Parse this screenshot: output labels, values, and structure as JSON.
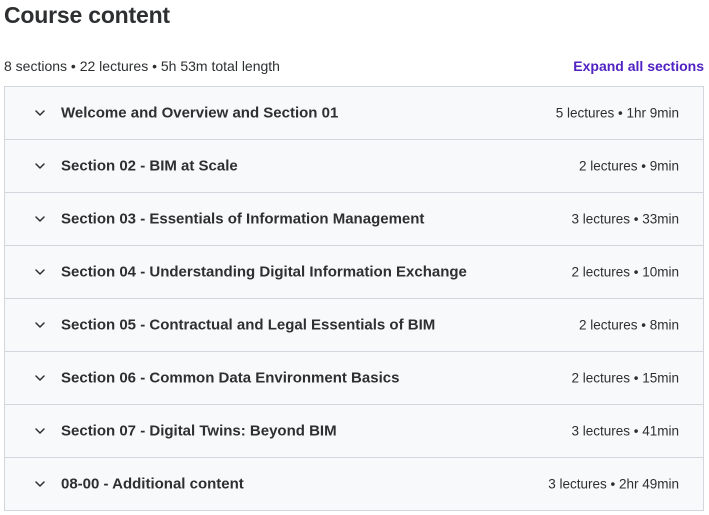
{
  "header": {
    "title": "Course content",
    "summary": "8 sections • 22 lectures • 5h 53m total length",
    "expand_label": "Expand all sections"
  },
  "sections": [
    {
      "title": "Welcome and Overview and Section 01",
      "meta": "5 lectures • 1hr 9min",
      "icon": "chevron-down-icon"
    },
    {
      "title": "Section 02 - BIM at Scale",
      "meta": "2 lectures • 9min",
      "icon": "chevron-down-icon"
    },
    {
      "title": "Section 03 - Essentials of Information Management",
      "meta": "3 lectures • 33min",
      "icon": "chevron-down-icon"
    },
    {
      "title": "Section 04 - Understanding Digital Information Exchange",
      "meta": "2 lectures • 10min",
      "icon": "chevron-down-icon"
    },
    {
      "title": "Section 05 - Contractual and Legal Essentials of BIM",
      "meta": "2 lectures • 8min",
      "icon": "chevron-down-icon"
    },
    {
      "title": "Section 06 - Common Data Environment Basics",
      "meta": "2 lectures • 15min",
      "icon": "chevron-down-icon"
    },
    {
      "title": "Section 07 - Digital Twins: Beyond BIM",
      "meta": "3 lectures • 41min",
      "icon": "chevron-down-icon"
    },
    {
      "title": "08-00 - Additional content",
      "meta": "3 lectures • 2hr 49min",
      "icon": "chevron-down-icon"
    }
  ],
  "colors": {
    "text": "#2d2f31",
    "link": "#5022c3",
    "section_bg": "#f7f9fa",
    "border": "#d1d7dc"
  }
}
